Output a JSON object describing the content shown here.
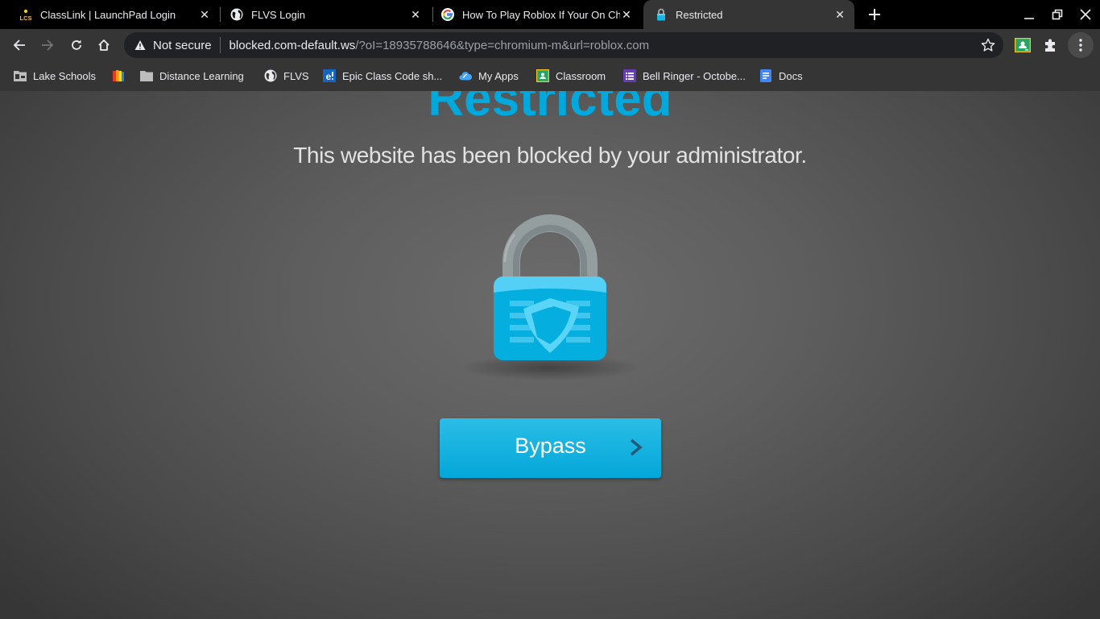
{
  "browser": {
    "tabs": [
      {
        "title": "ClassLink | LaunchPad Login",
        "favicon": "lcs-logo-icon",
        "active": false
      },
      {
        "title": "FLVS Login",
        "favicon": "globe-icon",
        "active": false
      },
      {
        "title": "How To Play Roblox If Your On Chromebook",
        "favicon": "google-icon",
        "active": false
      },
      {
        "title": "Restricted",
        "favicon": "lock-icon",
        "active": true
      }
    ],
    "new_tab_label": "+",
    "address_bar": {
      "security_label": "Not secure",
      "url_host": "blocked.com-default.ws",
      "url_rest": "/?oI=18935788646&type=chromium-m&url=roblox.com"
    },
    "bookmarks": [
      {
        "label": "Lake Schools",
        "icon": "folder-building-icon"
      },
      {
        "label": "",
        "icon": "colorful-book-icon"
      },
      {
        "label": "Distance Learning",
        "icon": "folder-icon"
      },
      {
        "label": "FLVS",
        "icon": "globe-icon"
      },
      {
        "label": "Epic Class Code sh...",
        "icon": "epic-icon"
      },
      {
        "label": "My Apps",
        "icon": "myapps-cloud-icon"
      },
      {
        "label": "Classroom",
        "icon": "google-classroom-icon"
      },
      {
        "label": "Bell Ringer - Octobe...",
        "icon": "google-forms-icon"
      },
      {
        "label": "Docs",
        "icon": "google-docs-icon"
      }
    ]
  },
  "page": {
    "heading": "Restricted",
    "message": "This website has been blocked by your administrator.",
    "bypass_button": "Bypass",
    "bypass_arrow": ">"
  },
  "colors": {
    "accent": "#00a9dd",
    "button_top": "#2bbde6",
    "button_bottom": "#03a7d9"
  }
}
